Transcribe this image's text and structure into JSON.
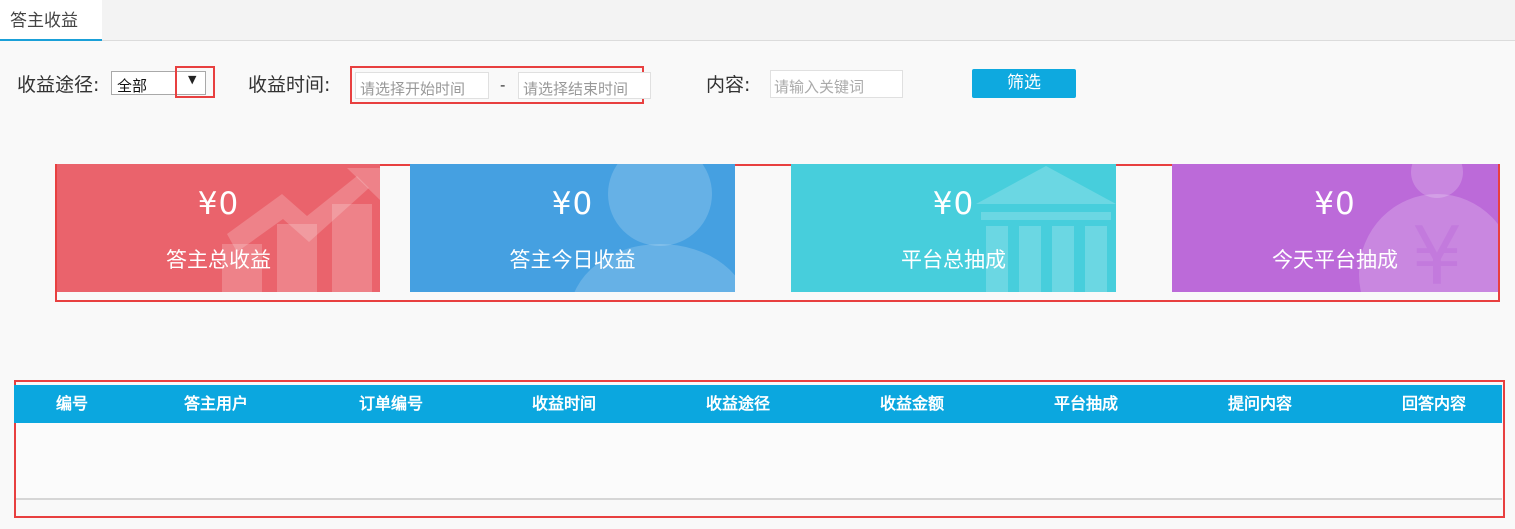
{
  "tabs": [
    {
      "label": "答主收益"
    }
  ],
  "filters": {
    "source_label": "收益途径:",
    "source_value": "全部",
    "time_label": "收益时间:",
    "start_placeholder": "请选择开始时间",
    "separator": "-",
    "end_placeholder": "请选择结束时间",
    "content_label": "内容:",
    "keyword_placeholder": "请输入关键词",
    "filter_button": "筛选"
  },
  "cards": [
    {
      "value": "¥0",
      "label": "答主总收益",
      "color": "#ea636c",
      "icon": "trend-chart-icon"
    },
    {
      "value": "¥0",
      "label": "答主今日收益",
      "color": "#45a0e1",
      "icon": "user-icon"
    },
    {
      "value": "¥0",
      "label": "平台总抽成",
      "color": "#47cedc",
      "icon": "bank-icon"
    },
    {
      "value": "¥0",
      "label": "今天平台抽成",
      "color": "#bc6ad9",
      "icon": "money-bag-icon"
    }
  ],
  "table": {
    "columns": [
      "编号",
      "答主用户",
      "订单编号",
      "收益时间",
      "收益途径",
      "收益金额",
      "平台抽成",
      "提问内容",
      "回答内容"
    ],
    "header_color": "#0ba7df",
    "rows": []
  }
}
